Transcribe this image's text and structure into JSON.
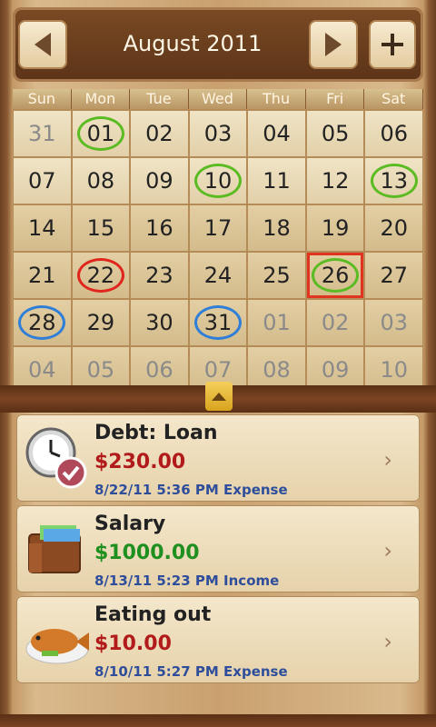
{
  "header": {
    "title": "August 2011",
    "prev_icon": "triangle-left-icon",
    "next_icon": "triangle-right-icon",
    "add_icon": "plus-icon"
  },
  "calendar": {
    "weekdays": [
      "Sun",
      "Mon",
      "Tue",
      "Wed",
      "Thu",
      "Fri",
      "Sat"
    ],
    "weeks": [
      [
        {
          "d": "31",
          "o": true
        },
        {
          "d": "01",
          "ring": "green"
        },
        {
          "d": "02"
        },
        {
          "d": "03"
        },
        {
          "d": "04"
        },
        {
          "d": "05"
        },
        {
          "d": "06"
        }
      ],
      [
        {
          "d": "07"
        },
        {
          "d": "08"
        },
        {
          "d": "09"
        },
        {
          "d": "10",
          "ring": "green"
        },
        {
          "d": "11"
        },
        {
          "d": "12"
        },
        {
          "d": "13",
          "ring": "green"
        }
      ],
      [
        {
          "d": "14"
        },
        {
          "d": "15"
        },
        {
          "d": "16"
        },
        {
          "d": "17"
        },
        {
          "d": "18"
        },
        {
          "d": "19"
        },
        {
          "d": "20"
        }
      ],
      [
        {
          "d": "21"
        },
        {
          "d": "22",
          "ring": "red"
        },
        {
          "d": "23"
        },
        {
          "d": "24"
        },
        {
          "d": "25"
        },
        {
          "d": "26",
          "ring": "green",
          "selected": true
        },
        {
          "d": "27"
        }
      ],
      [
        {
          "d": "28",
          "ring": "blue"
        },
        {
          "d": "29"
        },
        {
          "d": "30"
        },
        {
          "d": "31",
          "ring": "blue"
        },
        {
          "d": "01",
          "o": true
        },
        {
          "d": "02",
          "o": true
        },
        {
          "d": "03",
          "o": true
        }
      ],
      [
        {
          "d": "04",
          "o": true
        },
        {
          "d": "05",
          "o": true
        },
        {
          "d": "06",
          "o": true
        },
        {
          "d": "07",
          "o": true
        },
        {
          "d": "08",
          "o": true
        },
        {
          "d": "09",
          "o": true
        },
        {
          "d": "10",
          "o": true
        }
      ]
    ]
  },
  "transactions": [
    {
      "title": "Debt: Loan",
      "amount": "$230.00",
      "type": "expense",
      "meta": "8/22/11 5:36 PM Expense",
      "icon": "clock-check-icon"
    },
    {
      "title": "Salary",
      "amount": "$1000.00",
      "type": "income",
      "meta": "8/13/11 5:23 PM Income",
      "icon": "wallet-icon"
    },
    {
      "title": "Eating out",
      "amount": "$10.00",
      "type": "expense",
      "meta": "8/10/11 5:27 PM Expense",
      "icon": "fish-plate-icon"
    }
  ],
  "colors": {
    "expense": "#b11b1b",
    "income": "#1f8f1f",
    "meta": "#2e4e9c",
    "ring_green": "#5bbb22",
    "ring_red": "#e0251d",
    "ring_blue": "#2f7fd8"
  }
}
